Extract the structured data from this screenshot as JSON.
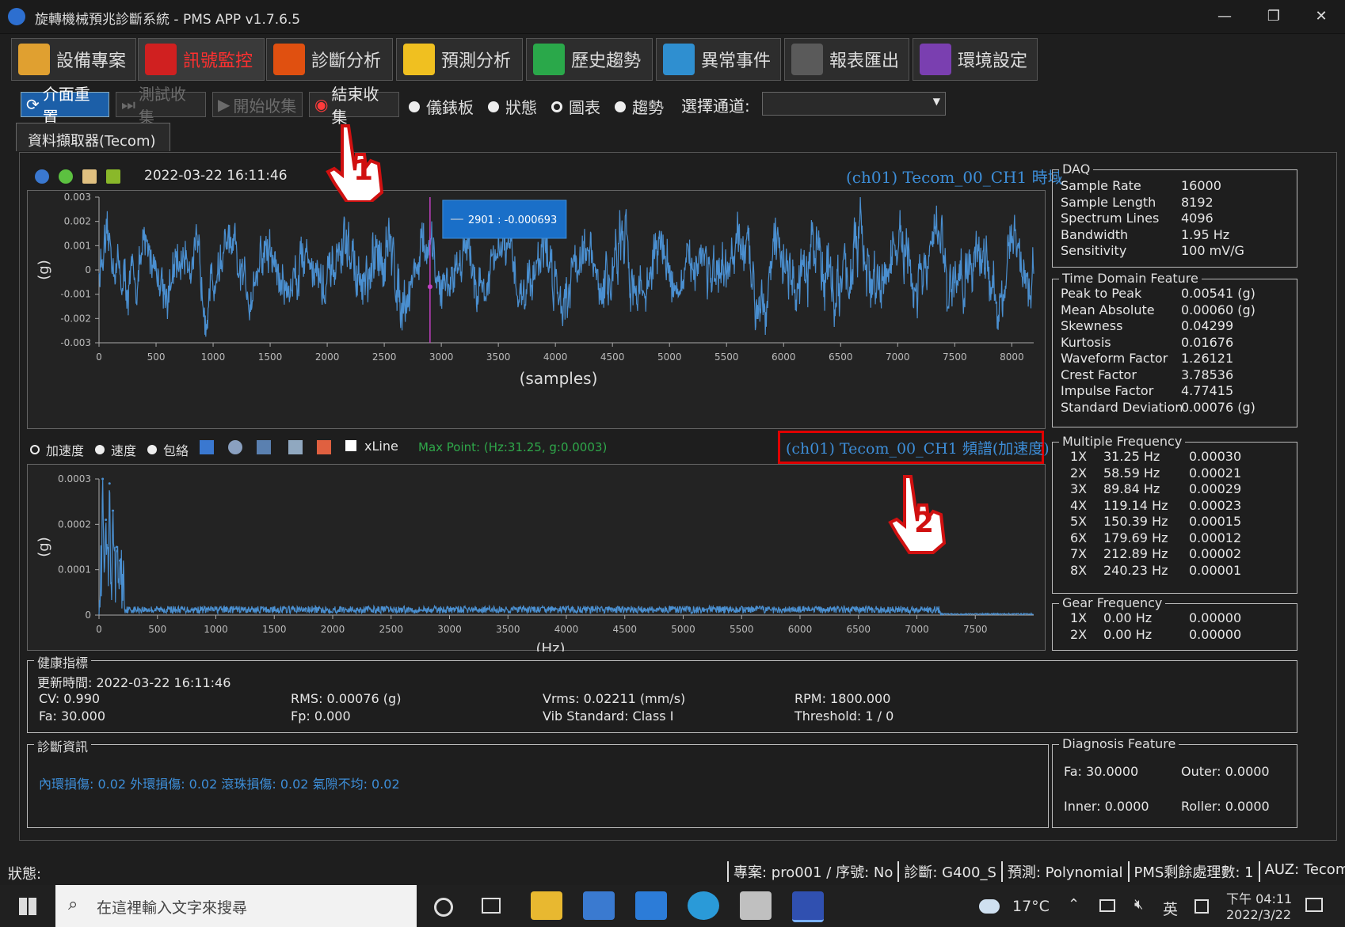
{
  "window": {
    "title": "旋轉機械預兆診斷系統 - PMS APP v1.7.6.5",
    "minimize": "—",
    "restore": "❐",
    "close": "✕"
  },
  "tabs": [
    {
      "label": "設備專案",
      "color": "#e0a030",
      "active": false
    },
    {
      "label": "訊號監控",
      "color": "#d02020",
      "active": true
    },
    {
      "label": "診斷分析",
      "color": "#e05010",
      "active": false
    },
    {
      "label": "預測分析",
      "color": "#f0c020",
      "active": false
    },
    {
      "label": "歷史趨勢",
      "color": "#2aa84a",
      "active": false
    },
    {
      "label": "異常事件",
      "color": "#2f8fd0",
      "active": false
    },
    {
      "label": "報表匯出",
      "color": "#5a5a5a",
      "active": false
    },
    {
      "label": "環境設定",
      "color": "#7a3fb0",
      "active": false
    }
  ],
  "toolbar": {
    "reset": "介面重置",
    "test_collect": "測試收集",
    "start_collect": "開始收集",
    "stop_collect": "結束收集",
    "radio_dashboard": "儀錶板",
    "radio_status": "狀態",
    "radio_chart": "圖表",
    "radio_trend": "趨勢",
    "channel_label": "選擇通道:",
    "channel_value": ""
  },
  "subtab": "資料擷取器(Tecom)",
  "time_chart": {
    "timestamp": "2022-03-22 16:11:46",
    "title": "(ch01) Tecom_00_CH1 時域",
    "tooltip": "2901 : -0.000693",
    "annotation_1": "1"
  },
  "spec_controls": {
    "accel": "加速度",
    "velocity": "速度",
    "envelope": "包絡",
    "xline": "xLine",
    "max_point": "Max Point: (Hz:31.25, g:0.0003)",
    "title": "(ch01) Tecom_00_CH1 頻譜(加速度)",
    "annotation_2": "2"
  },
  "chart_data": [
    {
      "type": "line",
      "title": "",
      "xlabel": "(samples)",
      "ylabel": "(g)",
      "xlim": [
        0,
        8192
      ],
      "ylim": [
        -0.003,
        0.003
      ],
      "x_ticks": [
        "0",
        "500",
        "1000",
        "1500",
        "2000",
        "2500",
        "3000",
        "3500",
        "4000",
        "4500",
        "5000",
        "5500",
        "6000",
        "6500",
        "7000",
        "7500",
        "8000"
      ],
      "y_ticks": [
        "0.003",
        "0.002",
        "0.001",
        "0",
        "-0.001",
        "-0.002",
        "-0.003"
      ],
      "cursor_x": 2901,
      "cursor_y": -0.000693,
      "series": [
        {
          "color": "#4a8fd0",
          "envelope_x": [
            0,
            500,
            1000,
            1500,
            2000,
            2500,
            3000,
            3500,
            4000,
            4500,
            5000,
            5500,
            6000,
            6500,
            7000,
            7500,
            8192
          ],
          "envelope_y": [
            0.0015,
            0.0017,
            0.0018,
            0.0017,
            0.0018,
            0.0022,
            0.0016,
            0.0017,
            0.0019,
            0.002,
            0.0018,
            0.0019,
            0.002,
            0.0022,
            0.0021,
            0.0022,
            0.0018
          ]
        }
      ]
    },
    {
      "type": "line",
      "title": "",
      "xlabel": "(Hz)",
      "ylabel": "(g)",
      "xlim": [
        0,
        8000
      ],
      "ylim": [
        0,
        0.0003
      ],
      "x_ticks": [
        "0",
        "500",
        "1000",
        "1500",
        "2000",
        "2500",
        "3000",
        "3500",
        "4000",
        "4500",
        "5000",
        "5500",
        "6000",
        "6500",
        "7000",
        "7500"
      ],
      "y_ticks": [
        "0.0003",
        "0.0002",
        "0.0001",
        "0"
      ],
      "peaks": [
        {
          "x": 31.25,
          "y": 0.0003
        },
        {
          "x": 58.59,
          "y": 0.00021
        },
        {
          "x": 89.84,
          "y": 0.00029
        },
        {
          "x": 119.14,
          "y": 0.00023
        },
        {
          "x": 150.39,
          "y": 0.00015
        },
        {
          "x": 179.69,
          "y": 0.00012
        }
      ],
      "floor_level": 2e-05,
      "series": [
        {
          "color": "#4a8fd0"
        }
      ]
    }
  ],
  "daq": {
    "title": "DAQ",
    "rows": [
      {
        "k": "Sample Rate",
        "v": "16000"
      },
      {
        "k": "Sample Length",
        "v": "8192"
      },
      {
        "k": "Spectrum Lines",
        "v": "4096"
      },
      {
        "k": "Bandwidth",
        "v": "1.95 Hz"
      },
      {
        "k": "Sensitivity",
        "v": "100 mV/G"
      }
    ]
  },
  "time_feature": {
    "title": "Time Domain Feature",
    "rows": [
      {
        "k": "Peak to Peak",
        "v": "0.00541 (g)"
      },
      {
        "k": "Mean Absolute",
        "v": "0.00060 (g)"
      },
      {
        "k": "Skewness",
        "v": "0.04299"
      },
      {
        "k": "Kurtosis",
        "v": "0.01676"
      },
      {
        "k": "Waveform Factor",
        "v": "1.26121"
      },
      {
        "k": "Crest Factor",
        "v": "3.78536"
      },
      {
        "k": "Impulse Factor",
        "v": "4.77415"
      },
      {
        "k": "Standard Deviation",
        "v": "0.00076 (g)"
      }
    ]
  },
  "multi_freq": {
    "title": "Multiple Frequency",
    "rows": [
      {
        "n": "1X",
        "hz": "31.25 Hz",
        "v": "0.00030"
      },
      {
        "n": "2X",
        "hz": "58.59 Hz",
        "v": "0.00021"
      },
      {
        "n": "3X",
        "hz": "89.84 Hz",
        "v": "0.00029"
      },
      {
        "n": "4X",
        "hz": "119.14 Hz",
        "v": "0.00023"
      },
      {
        "n": "5X",
        "hz": "150.39 Hz",
        "v": "0.00015"
      },
      {
        "n": "6X",
        "hz": "179.69 Hz",
        "v": "0.00012"
      },
      {
        "n": "7X",
        "hz": "212.89 Hz",
        "v": "0.00002"
      },
      {
        "n": "8X",
        "hz": "240.23 Hz",
        "v": "0.00001"
      }
    ]
  },
  "gear_freq": {
    "title": "Gear Frequency",
    "rows": [
      {
        "n": "1X",
        "hz": "0.00 Hz",
        "v": "0.00000"
      },
      {
        "n": "2X",
        "hz": "0.00 Hz",
        "v": "0.00000"
      }
    ]
  },
  "health": {
    "title": "健康指標",
    "updated": "更新時間: 2022-03-22 16:11:46",
    "cv": "CV: 0.990",
    "fa": "Fa: 30.000",
    "rms": "RMS: 0.00076 (g)",
    "fp": "Fp: 0.000",
    "vrms": "Vrms: 0.02211 (mm/s)",
    "vib": "Vib Standard: Class I",
    "rpm": "RPM: 1800.000",
    "threshold": "Threshold: 1 / 0"
  },
  "diagnosis": {
    "title": "診斷資訊",
    "text": "內環損傷: 0.02  外環損傷: 0.02  滾珠損傷: 0.02  氣隙不均: 0.02"
  },
  "diag_feature": {
    "title": "Diagnosis Feature",
    "fa": "Fa: 30.0000",
    "outer": "Outer: 0.0000",
    "inner": "Inner: 0.0000",
    "roller": "Roller: 0.0000"
  },
  "statusbar": {
    "label": "狀態:",
    "segments": [
      "專案: pro001 / 序號: No",
      "診斷: G400_S",
      "預測: Polynomial",
      "PMS剩餘處理數: 1",
      "AUZ: Tecom"
    ]
  },
  "taskbar": {
    "search_placeholder": "在這裡輸入文字來搜尋",
    "temp": "17°C",
    "ime": "英",
    "time": "下午 04:11",
    "date": "2022/3/22"
  }
}
